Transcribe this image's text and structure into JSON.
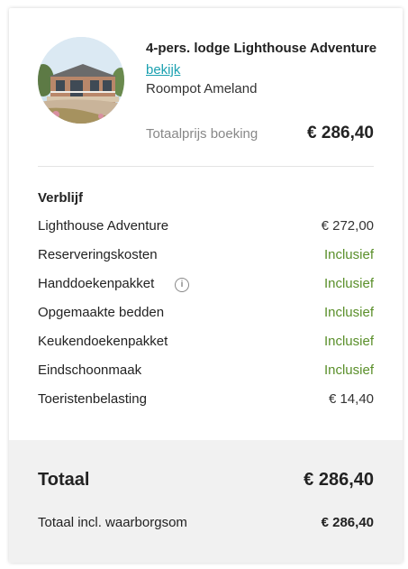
{
  "accommodation": {
    "title": "4-pers. lodge Lighthouse Adventure",
    "link_label": "bekijk",
    "park": "Roompot Ameland",
    "total_label": "Totaalprijs boeking",
    "total_value": "€ 286,40"
  },
  "stay": {
    "section_title": "Verblijf",
    "items": [
      {
        "label": "Lighthouse Adventure",
        "value": "€ 272,00",
        "type": "price"
      },
      {
        "label": "Reserveringskosten",
        "value": "Inclusief",
        "type": "included"
      },
      {
        "label": "Handdoekenpakket",
        "value": "Inclusief",
        "type": "included",
        "icon": "info-icon"
      },
      {
        "label": "Opgemaakte bedden",
        "value": "Inclusief",
        "type": "included"
      },
      {
        "label": "Keukendoekenpakket",
        "value": "Inclusief",
        "type": "included"
      },
      {
        "label": "Eindschoonmaak",
        "value": "Inclusief",
        "type": "included"
      },
      {
        "label": "Toeristenbelasting",
        "value": "€ 14,40",
        "type": "price"
      }
    ]
  },
  "summary": {
    "total_label": "Totaal",
    "total_value": "€ 286,40",
    "deposit_label": "Totaal incl. waarborgsom",
    "deposit_value": "€ 286,40"
  },
  "colors": {
    "link": "#1aa0b0",
    "included": "#5a8f2a",
    "footer_bg": "#f1f1f1"
  }
}
